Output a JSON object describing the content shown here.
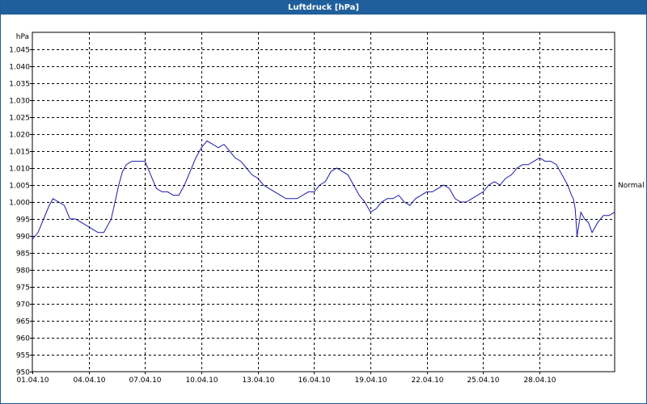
{
  "window": {
    "title": "Luftdruck [hPa]"
  },
  "chart_data": {
    "type": "line",
    "title": "Luftdruck [hPa]",
    "ylabel": "hPa",
    "xlabel": "",
    "ylim": [
      950,
      1050
    ],
    "xlim": [
      0,
      31
    ],
    "y_ticks": [
      950,
      955,
      960,
      965,
      970,
      975,
      980,
      985,
      990,
      995,
      1000,
      1005,
      1010,
      1015,
      1020,
      1025,
      1030,
      1035,
      1040,
      1045
    ],
    "y_tick_labels": [
      "950",
      "955",
      "960",
      "965",
      "970",
      "975",
      "980",
      "985",
      "990",
      "995",
      "1.000",
      "1.005",
      "1.010",
      "1.015",
      "1.020",
      "1.025",
      "1.030",
      "1.035",
      "1.040",
      "1.045"
    ],
    "x_ticks": [
      0,
      3,
      6,
      9,
      12,
      15,
      18,
      21,
      24,
      27
    ],
    "x_tick_labels": [
      "01.04.10",
      "04.04.10",
      "07.04.10",
      "10.04.10",
      "13.04.10",
      "16.04.10",
      "19.04.10",
      "22.04.10",
      "25.04.10",
      "28.04.10"
    ],
    "grid": true,
    "grid_style": "dashed",
    "line_color": "#1a1aa8",
    "reference_line": {
      "label": "Normal",
      "value": 1005
    },
    "series": [
      {
        "name": "",
        "x": [
          0,
          0.3,
          0.6,
          0.9,
          1.1,
          1.4,
          1.7,
          2.0,
          2.3,
          2.6,
          2.9,
          3.2,
          3.5,
          3.8,
          4.0,
          4.2,
          4.4,
          4.6,
          4.8,
          5.0,
          5.3,
          5.6,
          6.0,
          6.3,
          6.6,
          6.9,
          7.2,
          7.5,
          7.8,
          8.1,
          8.4,
          8.7,
          9.0,
          9.3,
          9.6,
          9.9,
          10.2,
          10.5,
          10.8,
          11.1,
          11.4,
          11.7,
          12.0,
          12.3,
          12.6,
          12.9,
          13.2,
          13.5,
          13.8,
          14.1,
          14.4,
          14.7,
          15.0,
          15.3,
          15.6,
          15.9,
          16.2,
          16.5,
          16.8,
          17.1,
          17.4,
          17.7,
          18.0,
          18.3,
          18.6,
          18.9,
          19.2,
          19.5,
          19.8,
          20.1,
          20.4,
          20.7,
          21.0,
          21.3,
          21.6,
          21.9,
          22.2,
          22.5,
          22.8,
          23.1,
          23.4,
          23.7,
          24.0,
          24.3,
          24.6,
          24.9,
          25.2,
          25.5,
          25.8,
          26.1,
          26.4,
          26.7,
          27.0,
          27.3,
          27.6,
          27.9,
          28.2,
          28.5,
          28.7,
          28.8,
          28.9,
          29.0,
          29.2,
          29.4,
          29.6,
          29.8,
          30.1,
          30.4,
          30.7,
          31.0
        ],
        "values": [
          989,
          991,
          995,
          999,
          1001,
          1000,
          999,
          995,
          995,
          994,
          993,
          992,
          991,
          991,
          993,
          995,
          1000,
          1005,
          1009,
          1011,
          1012,
          1012,
          1012,
          1008,
          1004,
          1003,
          1003,
          1002,
          1002,
          1005,
          1009,
          1013,
          1016,
          1018,
          1017,
          1016,
          1017,
          1015,
          1013,
          1012,
          1010,
          1008,
          1007,
          1005,
          1004,
          1003,
          1002,
          1001,
          1001,
          1001,
          1002,
          1003,
          1003,
          1005,
          1006,
          1009,
          1010,
          1009,
          1008,
          1005,
          1002,
          1000,
          997,
          998,
          1000,
          1001,
          1001,
          1002,
          1000,
          999,
          1001,
          1002,
          1003,
          1003,
          1004,
          1005,
          1004,
          1001,
          1000,
          1000,
          1001,
          1002,
          1003,
          1005,
          1006,
          1005,
          1007,
          1008,
          1010,
          1011,
          1011,
          1012,
          1013,
          1012,
          1012,
          1011,
          1008,
          1005,
          1002,
          1001,
          998,
          990,
          997,
          995,
          994,
          991,
          994,
          996,
          996,
          997
        ]
      }
    ]
  }
}
